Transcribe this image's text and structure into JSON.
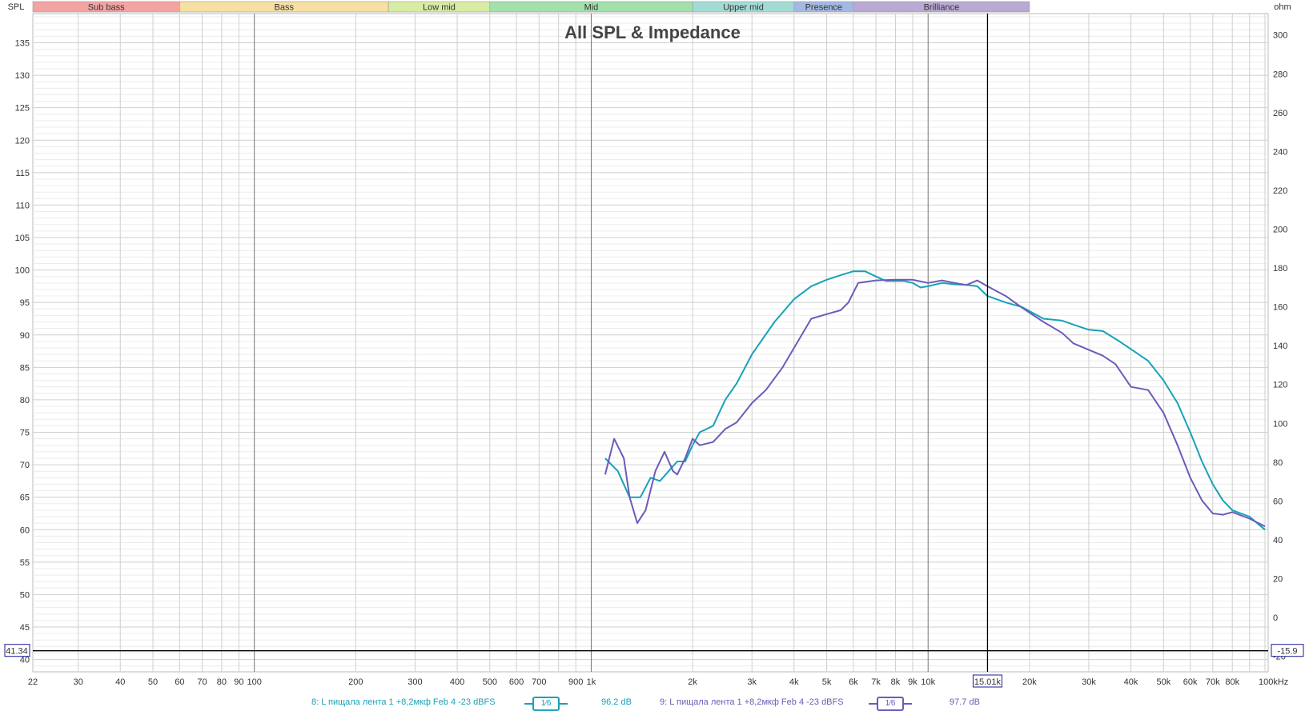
{
  "chart_data": {
    "type": "line",
    "title": "All SPL & Impedance",
    "ylabel": "SPL",
    "y2label": "ohm",
    "xunit": "Hz",
    "xscale": "log",
    "xlim": [
      22,
      100000
    ],
    "ylim": [
      38.1,
      139.5
    ],
    "y2lim": [
      -28,
      311
    ],
    "yticks": [
      40,
      45,
      50,
      55,
      60,
      65,
      70,
      75,
      80,
      85,
      90,
      95,
      100,
      105,
      110,
      115,
      120,
      125,
      130,
      135
    ],
    "y2ticks": [
      -20,
      0,
      20,
      40,
      60,
      80,
      100,
      120,
      140,
      160,
      180,
      200,
      220,
      240,
      260,
      280,
      300
    ],
    "xticks": [
      {
        "v": 22,
        "l": "22"
      },
      {
        "v": 30,
        "l": "30"
      },
      {
        "v": 40,
        "l": "40"
      },
      {
        "v": 50,
        "l": "50"
      },
      {
        "v": 60,
        "l": "60"
      },
      {
        "v": 70,
        "l": "70"
      },
      {
        "v": 80,
        "l": "80"
      },
      {
        "v": 90,
        "l": "90"
      },
      {
        "v": 100,
        "l": "100"
      },
      {
        "v": 200,
        "l": "200"
      },
      {
        "v": 300,
        "l": "300"
      },
      {
        "v": 400,
        "l": "400"
      },
      {
        "v": 500,
        "l": "500"
      },
      {
        "v": 600,
        "l": "600"
      },
      {
        "v": 700,
        "l": "700"
      },
      {
        "v": 900,
        "l": "900"
      },
      {
        "v": 1000,
        "l": "1k"
      },
      {
        "v": 2000,
        "l": "2k"
      },
      {
        "v": 3000,
        "l": "3k"
      },
      {
        "v": 4000,
        "l": "4k"
      },
      {
        "v": 5000,
        "l": "5k"
      },
      {
        "v": 6000,
        "l": "6k"
      },
      {
        "v": 7000,
        "l": "7k"
      },
      {
        "v": 8000,
        "l": "8k"
      },
      {
        "v": 9000,
        "l": "9k"
      },
      {
        "v": 10000,
        "l": "10k"
      },
      {
        "v": 20000,
        "l": "20k"
      },
      {
        "v": 30000,
        "l": "30k"
      },
      {
        "v": 40000,
        "l": "40k"
      },
      {
        "v": 50000,
        "l": "50k"
      },
      {
        "v": 60000,
        "l": "60k"
      },
      {
        "v": 70000,
        "l": "70k"
      },
      {
        "v": 80000,
        "l": "80k"
      },
      {
        "v": 100000,
        "l": "100kHz"
      }
    ],
    "bands": [
      {
        "name": "Sub bass",
        "from": 22,
        "to": 60,
        "color": "#f4a3a3"
      },
      {
        "name": "Bass",
        "from": 60,
        "to": 250,
        "color": "#f8dfa2"
      },
      {
        "name": "Low mid",
        "from": 250,
        "to": 500,
        "color": "#d8eca4"
      },
      {
        "name": "Mid",
        "from": 500,
        "to": 2000,
        "color": "#a3e0ab"
      },
      {
        "name": "Upper mid",
        "from": 2000,
        "to": 4000,
        "color": "#a3dcd5"
      },
      {
        "name": "Presence",
        "from": 4000,
        "to": 6000,
        "color": "#a4b9e2"
      },
      {
        "name": "Brilliance",
        "from": 6000,
        "to": 20000,
        "color": "#b9a9d3"
      }
    ],
    "cursor": {
      "x": 15010,
      "x_label": "15.01k",
      "y": 41.34,
      "y_label": "41.34",
      "y2_label": "-15.9"
    },
    "series": [
      {
        "name": "8: L пищала лента 1 +8,2мкф Feb 4 -23 dBFS",
        "smoothing": "1⁄6",
        "level": "96.2 dB",
        "color": "#17a2b8",
        "x": [
          1100,
          1200,
          1300,
          1400,
          1500,
          1600,
          1800,
          1900,
          2000,
          2100,
          2300,
          2500,
          2700,
          3000,
          3500,
          4000,
          4500,
          5000,
          5500,
          6000,
          6500,
          7000,
          7500,
          8500,
          9000,
          9500,
          10000,
          11000,
          12000,
          13000,
          14000,
          15000,
          17000,
          19000,
          22000,
          25000,
          28000,
          30000,
          33000,
          37000,
          40000,
          45000,
          50000,
          55000,
          60000,
          65000,
          70000,
          75000,
          80000,
          90000,
          100000
        ],
        "y": [
          71,
          69,
          65,
          65,
          68,
          67.5,
          70.5,
          70.5,
          73,
          75,
          76,
          80,
          82.5,
          87,
          92,
          95.5,
          97.5,
          98.5,
          99.2,
          99.8,
          99.8,
          99,
          98.3,
          98.3,
          98,
          97.3,
          97.5,
          98,
          97.8,
          97.7,
          97.5,
          96,
          95,
          94.3,
          92.5,
          92.2,
          91.3,
          90.8,
          90.6,
          89,
          87.8,
          86,
          83,
          79.5,
          75,
          70.5,
          67,
          64.5,
          63,
          62,
          60
        ]
      },
      {
        "name": "9: L пищала лента 1 +8,2мкф Feb 4 -23 dBFS",
        "smoothing": "1⁄6",
        "level": "97.7 dB",
        "color": "#6a5cb8",
        "x": [
          1100,
          1170,
          1250,
          1300,
          1370,
          1450,
          1550,
          1650,
          1750,
          1800,
          1900,
          2000,
          2100,
          2300,
          2500,
          2700,
          3000,
          3300,
          3700,
          4000,
          4500,
          5000,
          5500,
          5800,
          6200,
          7000,
          8000,
          9000,
          10000,
          11000,
          12000,
          13000,
          14000,
          15000,
          17000,
          19000,
          22000,
          25000,
          27000,
          30000,
          33000,
          36000,
          40000,
          45000,
          50000,
          55000,
          60000,
          65000,
          70000,
          75000,
          80000,
          90000,
          100000
        ],
        "y": [
          68.5,
          74,
          71,
          65,
          61,
          63,
          69,
          72,
          69,
          68.5,
          71,
          74,
          73,
          73.5,
          75.5,
          76.5,
          79.5,
          81.5,
          85,
          88,
          92.5,
          93.2,
          93.8,
          95,
          98,
          98.4,
          98.5,
          98.5,
          98,
          98.4,
          98,
          97.7,
          98.4,
          97.5,
          96,
          94.2,
          92,
          90.3,
          88.7,
          87.7,
          86.8,
          85.5,
          82,
          81.5,
          78,
          73,
          68,
          64.5,
          62.5,
          62.3,
          62.7,
          61.7,
          60.5
        ]
      }
    ]
  }
}
